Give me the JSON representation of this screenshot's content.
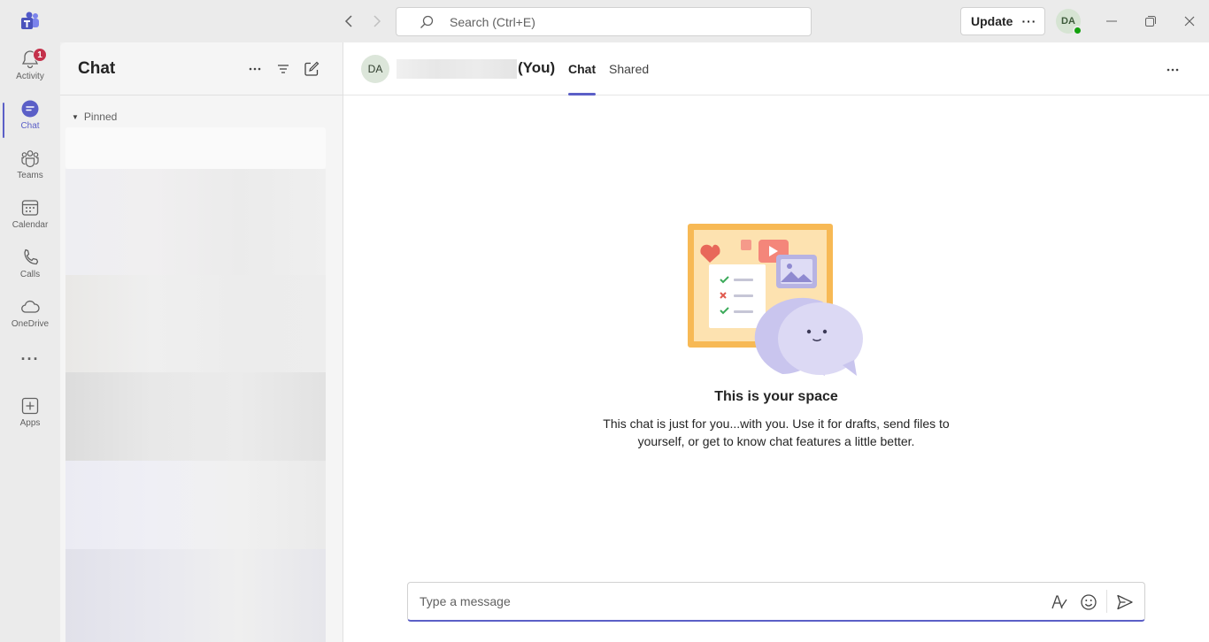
{
  "titlebar": {
    "search_placeholder": "Search (Ctrl+E)",
    "update_label": "Update",
    "update_more": "···",
    "user_initials": "DA"
  },
  "rail": {
    "items": [
      {
        "label": "Activity",
        "icon": "bell-icon",
        "badge": "1"
      },
      {
        "label": "Chat",
        "icon": "chat-icon",
        "active": true
      },
      {
        "label": "Teams",
        "icon": "teams-icon"
      },
      {
        "label": "Calendar",
        "icon": "calendar-icon"
      },
      {
        "label": "Calls",
        "icon": "phone-icon"
      },
      {
        "label": "OneDrive",
        "icon": "cloud-icon"
      },
      {
        "label": "Apps",
        "icon": "add-app-icon"
      }
    ],
    "more_label": "···"
  },
  "chat_list": {
    "title": "Chat",
    "pinned_label": "Pinned"
  },
  "conversation": {
    "avatar_initials": "DA",
    "name_suffix": "(You)",
    "tabs": [
      {
        "label": "Chat",
        "active": true
      },
      {
        "label": "Shared",
        "active": false
      }
    ],
    "more": "···",
    "empty_title": "This is your space",
    "empty_desc": "This chat is just for you...with you. Use it for drafts, send files to yourself, or get to know chat features a little better.",
    "compose_placeholder": "Type a message"
  },
  "colors": {
    "accent": "#5b5fc7",
    "presence": "#13a10e",
    "badge": "#c4314b"
  }
}
